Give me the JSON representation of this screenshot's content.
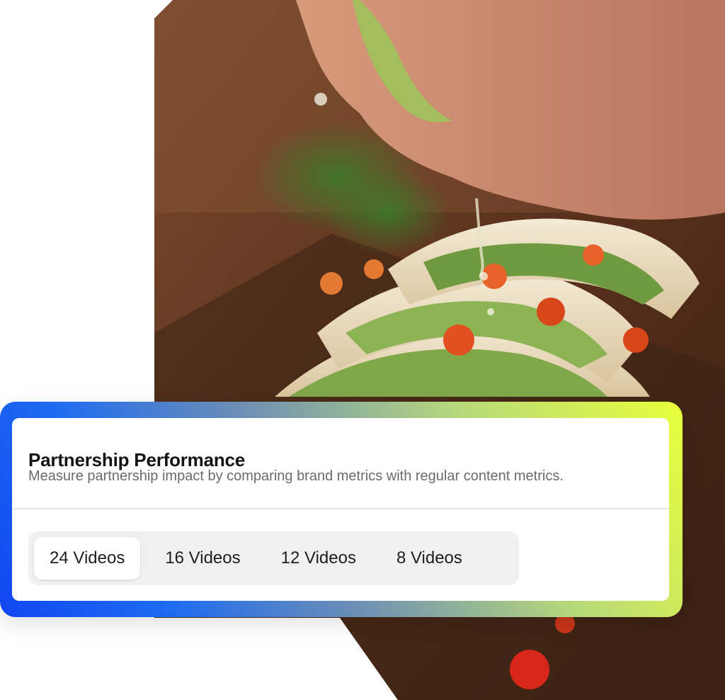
{
  "card": {
    "title": "Partnership Performance",
    "subtitle": "Measure partnership impact by comparing brand metrics with regular content metrics."
  },
  "segments": {
    "items": [
      {
        "label": "24 Videos",
        "active": true
      },
      {
        "label": "16 Videos",
        "active": false
      },
      {
        "label": "12 Videos",
        "active": false
      },
      {
        "label": "8 Videos",
        "active": false
      }
    ]
  },
  "colors": {
    "gradient_start": "#1146f2",
    "gradient_end": "#e9ff3a",
    "title": "#141414",
    "subtitle": "#6b6b6b",
    "segment_track": "#f0f0f0"
  }
}
